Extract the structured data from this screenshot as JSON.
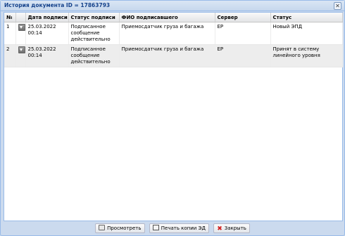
{
  "window": {
    "title": "История документа ID = 17863793",
    "close_glyph": "✕"
  },
  "grid": {
    "columns": [
      "№",
      "",
      "Дата подписи",
      "Статус подписи",
      "ФИО подписавшего",
      "Сервер",
      "Статус"
    ],
    "rows": [
      {
        "num": "1",
        "date": "25.03.2022 00:14",
        "sign_status": "Подписанное сообщение действительно",
        "signer": "Приемосдатчик груза и багажа",
        "server": "EP",
        "status": "Новый ЭПД"
      },
      {
        "num": "2",
        "date": "25.03.2022 00:14",
        "sign_status": "Подписанное сообщение действительно",
        "signer": "Приемосдатчик груза и багажа",
        "server": "EP",
        "status": "Принят в систему линейного уровня"
      }
    ]
  },
  "toolbar": {
    "view_label": "Просмотреть",
    "print_label": "Печать копии ЭД",
    "close_label": "Закрыть"
  },
  "icons": {
    "download": "download-icon",
    "view": "view-icon",
    "print": "print-icon",
    "close": "close-icon"
  }
}
